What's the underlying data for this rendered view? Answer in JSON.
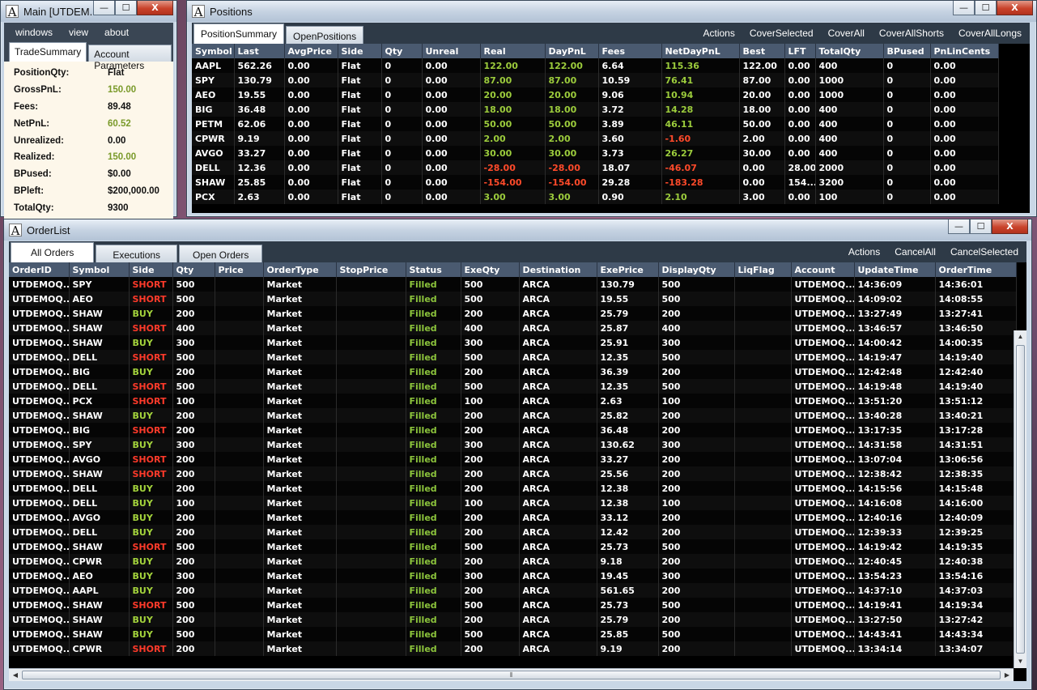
{
  "main_window": {
    "title": "Main [UTDEM...",
    "menu": [
      "windows",
      "view",
      "about"
    ],
    "tabs": [
      "TradeSummary",
      "Account Parameters"
    ],
    "summary": [
      {
        "label": "PositionQty:",
        "value": "Flat",
        "tone": "normal"
      },
      {
        "label": "GrossPnL:",
        "value": "150.00",
        "tone": "green"
      },
      {
        "label": "Fees:",
        "value": "89.48",
        "tone": "normal"
      },
      {
        "label": "NetPnL:",
        "value": "60.52",
        "tone": "green"
      },
      {
        "label": "Unrealized:",
        "value": "0.00",
        "tone": "normal"
      },
      {
        "label": "Realized:",
        "value": "150.00",
        "tone": "green"
      },
      {
        "label": "BPused:",
        "value": "$0.00",
        "tone": "normal"
      },
      {
        "label": "BPleft:",
        "value": "$200,000.00",
        "tone": "normal"
      },
      {
        "label": "TotalQty:",
        "value": "9300",
        "tone": "normal"
      }
    ]
  },
  "positions_window": {
    "title": "Positions",
    "tabs": [
      "PositionSummary",
      "OpenPositions"
    ],
    "actions": [
      "Actions",
      "CoverSelected",
      "CoverAll",
      "CoverAllShorts",
      "CoverAllLongs"
    ],
    "columns": [
      "Symbol",
      "Last",
      "AvgPrice",
      "Side",
      "Qty",
      "Unreal",
      "Real",
      "DayPnL",
      "Fees",
      "NetDayPnL",
      "Best",
      "LFT",
      "TotalQty",
      "BPused",
      "PnLinCents"
    ],
    "rows": [
      [
        "AAPL",
        "562.26",
        "0.00",
        "Flat",
        "0",
        "0.00",
        "122.00",
        "122.00",
        "6.64",
        "115.36",
        "122.00",
        "0.00",
        "400",
        "0",
        "0.00"
      ],
      [
        "SPY",
        "130.79",
        "0.00",
        "Flat",
        "0",
        "0.00",
        "87.00",
        "87.00",
        "10.59",
        "76.41",
        "87.00",
        "0.00",
        "1000",
        "0",
        "0.00"
      ],
      [
        "AEO",
        "19.55",
        "0.00",
        "Flat",
        "0",
        "0.00",
        "20.00",
        "20.00",
        "9.06",
        "10.94",
        "20.00",
        "0.00",
        "1000",
        "0",
        "0.00"
      ],
      [
        "BIG",
        "36.48",
        "0.00",
        "Flat",
        "0",
        "0.00",
        "18.00",
        "18.00",
        "3.72",
        "14.28",
        "18.00",
        "0.00",
        "400",
        "0",
        "0.00"
      ],
      [
        "PETM",
        "62.06",
        "0.00",
        "Flat",
        "0",
        "0.00",
        "50.00",
        "50.00",
        "3.89",
        "46.11",
        "50.00",
        "0.00",
        "400",
        "0",
        "0.00"
      ],
      [
        "CPWR",
        "9.19",
        "0.00",
        "Flat",
        "0",
        "0.00",
        "2.00",
        "2.00",
        "3.60",
        "-1.60",
        "2.00",
        "0.00",
        "400",
        "0",
        "0.00"
      ],
      [
        "AVGO",
        "33.27",
        "0.00",
        "Flat",
        "0",
        "0.00",
        "30.00",
        "30.00",
        "3.73",
        "26.27",
        "30.00",
        "0.00",
        "400",
        "0",
        "0.00"
      ],
      [
        "DELL",
        "12.36",
        "0.00",
        "Flat",
        "0",
        "0.00",
        "-28.00",
        "-28.00",
        "18.07",
        "-46.07",
        "0.00",
        "28.00",
        "2000",
        "0",
        "0.00"
      ],
      [
        "SHAW",
        "25.85",
        "0.00",
        "Flat",
        "0",
        "0.00",
        "-154.00",
        "-154.00",
        "29.28",
        "-183.28",
        "0.00",
        "154....",
        "3200",
        "0",
        "0.00"
      ],
      [
        "PCX",
        "2.63",
        "0.00",
        "Flat",
        "0",
        "0.00",
        "3.00",
        "3.00",
        "0.90",
        "2.10",
        "3.00",
        "0.00",
        "100",
        "0",
        "0.00"
      ]
    ]
  },
  "orders_window": {
    "title": "OrderList",
    "tabs": [
      "All Orders",
      "Executions",
      "Open Orders"
    ],
    "actions": [
      "Actions",
      "CancelAll",
      "CancelSelected"
    ],
    "columns": [
      "OrderID",
      "Symbol",
      "Side",
      "Qty",
      "Price",
      "OrderType",
      "StopPrice",
      "Status",
      "ExeQty",
      "Destination",
      "ExePrice",
      "DisplayQty",
      "LiqFlag",
      "Account",
      "UpdateTime",
      "OrderTime"
    ],
    "rows": [
      [
        "UTDEMOQ...",
        "SPY",
        "SHORT",
        "500",
        "",
        "Market",
        "",
        "Filled",
        "500",
        "ARCA",
        "130.79",
        "500",
        "",
        "UTDEMOQ...",
        "14:36:09",
        "14:36:01"
      ],
      [
        "UTDEMOQ...",
        "AEO",
        "SHORT",
        "500",
        "",
        "Market",
        "",
        "Filled",
        "500",
        "ARCA",
        "19.55",
        "500",
        "",
        "UTDEMOQ...",
        "14:09:02",
        "14:08:55"
      ],
      [
        "UTDEMOQ...",
        "SHAW",
        "BUY",
        "200",
        "",
        "Market",
        "",
        "Filled",
        "200",
        "ARCA",
        "25.79",
        "200",
        "",
        "UTDEMOQ...",
        "13:27:49",
        "13:27:41"
      ],
      [
        "UTDEMOQ...",
        "SHAW",
        "SHORT",
        "400",
        "",
        "Market",
        "",
        "Filled",
        "400",
        "ARCA",
        "25.87",
        "400",
        "",
        "UTDEMOQ...",
        "13:46:57",
        "13:46:50"
      ],
      [
        "UTDEMOQ...",
        "SHAW",
        "BUY",
        "300",
        "",
        "Market",
        "",
        "Filled",
        "300",
        "ARCA",
        "25.91",
        "300",
        "",
        "UTDEMOQ...",
        "14:00:42",
        "14:00:35"
      ],
      [
        "UTDEMOQ...",
        "DELL",
        "SHORT",
        "500",
        "",
        "Market",
        "",
        "Filled",
        "500",
        "ARCA",
        "12.35",
        "500",
        "",
        "UTDEMOQ...",
        "14:19:47",
        "14:19:40"
      ],
      [
        "UTDEMOQ...",
        "BIG",
        "BUY",
        "200",
        "",
        "Market",
        "",
        "Filled",
        "200",
        "ARCA",
        "36.39",
        "200",
        "",
        "UTDEMOQ...",
        "12:42:48",
        "12:42:40"
      ],
      [
        "UTDEMOQ...",
        "DELL",
        "SHORT",
        "500",
        "",
        "Market",
        "",
        "Filled",
        "500",
        "ARCA",
        "12.35",
        "500",
        "",
        "UTDEMOQ...",
        "14:19:48",
        "14:19:40"
      ],
      [
        "UTDEMOQ...",
        "PCX",
        "SHORT",
        "100",
        "",
        "Market",
        "",
        "Filled",
        "100",
        "ARCA",
        "2.63",
        "100",
        "",
        "UTDEMOQ...",
        "13:51:20",
        "13:51:12"
      ],
      [
        "UTDEMOQ...",
        "SHAW",
        "BUY",
        "200",
        "",
        "Market",
        "",
        "Filled",
        "200",
        "ARCA",
        "25.82",
        "200",
        "",
        "UTDEMOQ...",
        "13:40:28",
        "13:40:21"
      ],
      [
        "UTDEMOQ...",
        "BIG",
        "SHORT",
        "200",
        "",
        "Market",
        "",
        "Filled",
        "200",
        "ARCA",
        "36.48",
        "200",
        "",
        "UTDEMOQ...",
        "13:17:35",
        "13:17:28"
      ],
      [
        "UTDEMOQ...",
        "SPY",
        "BUY",
        "300",
        "",
        "Market",
        "",
        "Filled",
        "300",
        "ARCA",
        "130.62",
        "300",
        "",
        "UTDEMOQ...",
        "14:31:58",
        "14:31:51"
      ],
      [
        "UTDEMOQ...",
        "AVGO",
        "SHORT",
        "200",
        "",
        "Market",
        "",
        "Filled",
        "200",
        "ARCA",
        "33.27",
        "200",
        "",
        "UTDEMOQ...",
        "13:07:04",
        "13:06:56"
      ],
      [
        "UTDEMOQ...",
        "SHAW",
        "SHORT",
        "200",
        "",
        "Market",
        "",
        "Filled",
        "200",
        "ARCA",
        "25.56",
        "200",
        "",
        "UTDEMOQ...",
        "12:38:42",
        "12:38:35"
      ],
      [
        "UTDEMOQ...",
        "DELL",
        "BUY",
        "200",
        "",
        "Market",
        "",
        "Filled",
        "200",
        "ARCA",
        "12.38",
        "200",
        "",
        "UTDEMOQ...",
        "14:15:56",
        "14:15:48"
      ],
      [
        "UTDEMOQ...",
        "DELL",
        "BUY",
        "100",
        "",
        "Market",
        "",
        "Filled",
        "100",
        "ARCA",
        "12.38",
        "100",
        "",
        "UTDEMOQ...",
        "14:16:08",
        "14:16:00"
      ],
      [
        "UTDEMOQ...",
        "AVGO",
        "BUY",
        "200",
        "",
        "Market",
        "",
        "Filled",
        "200",
        "ARCA",
        "33.12",
        "200",
        "",
        "UTDEMOQ...",
        "12:40:16",
        "12:40:09"
      ],
      [
        "UTDEMOQ...",
        "DELL",
        "BUY",
        "200",
        "",
        "Market",
        "",
        "Filled",
        "200",
        "ARCA",
        "12.42",
        "200",
        "",
        "UTDEMOQ...",
        "12:39:33",
        "12:39:25"
      ],
      [
        "UTDEMOQ...",
        "SHAW",
        "SHORT",
        "500",
        "",
        "Market",
        "",
        "Filled",
        "500",
        "ARCA",
        "25.73",
        "500",
        "",
        "UTDEMOQ...",
        "14:19:42",
        "14:19:35"
      ],
      [
        "UTDEMOQ...",
        "CPWR",
        "BUY",
        "200",
        "",
        "Market",
        "",
        "Filled",
        "200",
        "ARCA",
        "9.18",
        "200",
        "",
        "UTDEMOQ...",
        "12:40:45",
        "12:40:38"
      ],
      [
        "UTDEMOQ...",
        "AEO",
        "BUY",
        "300",
        "",
        "Market",
        "",
        "Filled",
        "300",
        "ARCA",
        "19.45",
        "300",
        "",
        "UTDEMOQ...",
        "13:54:23",
        "13:54:16"
      ],
      [
        "UTDEMOQ...",
        "AAPL",
        "BUY",
        "200",
        "",
        "Market",
        "",
        "Filled",
        "200",
        "ARCA",
        "561.65",
        "200",
        "",
        "UTDEMOQ...",
        "14:37:10",
        "14:37:03"
      ],
      [
        "UTDEMOQ...",
        "SHAW",
        "SHORT",
        "500",
        "",
        "Market",
        "",
        "Filled",
        "500",
        "ARCA",
        "25.73",
        "500",
        "",
        "UTDEMOQ...",
        "14:19:41",
        "14:19:34"
      ],
      [
        "UTDEMOQ...",
        "SHAW",
        "BUY",
        "200",
        "",
        "Market",
        "",
        "Filled",
        "200",
        "ARCA",
        "25.79",
        "200",
        "",
        "UTDEMOQ...",
        "13:27:50",
        "13:27:42"
      ],
      [
        "UTDEMOQ...",
        "SHAW",
        "BUY",
        "500",
        "",
        "Market",
        "",
        "Filled",
        "500",
        "ARCA",
        "25.85",
        "500",
        "",
        "UTDEMOQ...",
        "14:43:41",
        "14:43:34"
      ],
      [
        "UTDEMOQ...",
        "CPWR",
        "SHORT",
        "200",
        "",
        "Market",
        "",
        "Filled",
        "200",
        "ARCA",
        "9.19",
        "200",
        "",
        "UTDEMOQ...",
        "13:34:14",
        "13:34:07"
      ]
    ]
  },
  "window_buttons": {
    "minimize": "—",
    "maximize": "☐",
    "close": "X"
  },
  "icons": {
    "app": "A"
  },
  "colors": {
    "positive": "#9ccc3c",
    "negative": "#ff4a2a",
    "short": "#ff3a2a",
    "buy": "#a4d43c",
    "filled": "#8cc43c",
    "header": "#4a5a70"
  }
}
